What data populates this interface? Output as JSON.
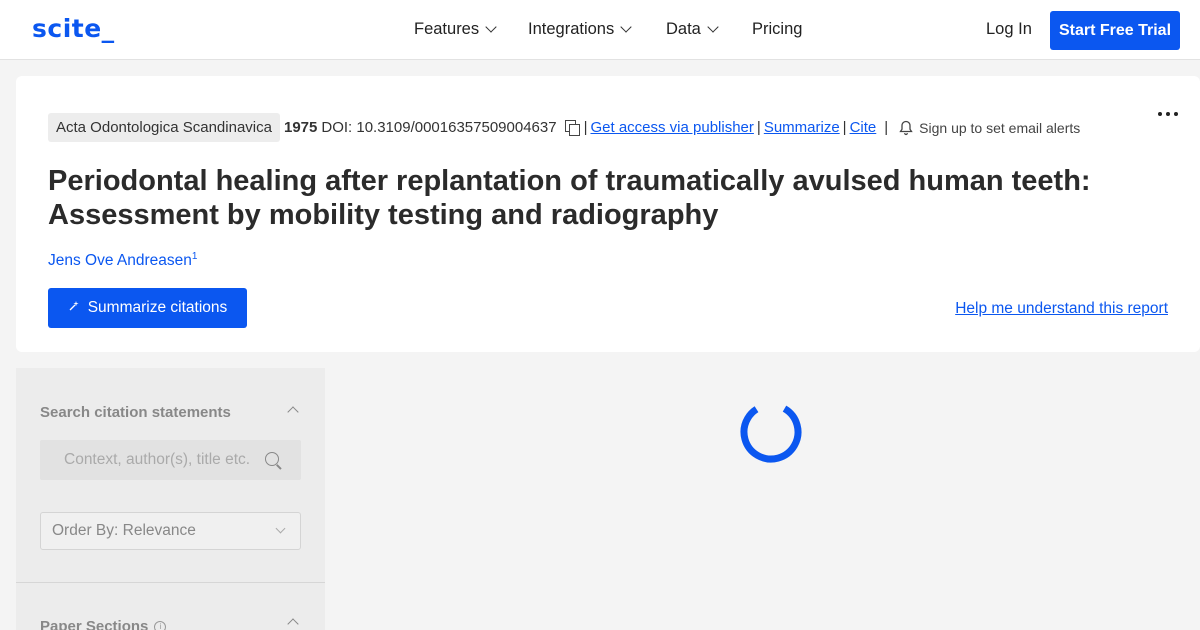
{
  "nav": {
    "logo": "scite_",
    "menu": [
      {
        "label": "Features",
        "has_dropdown": true
      },
      {
        "label": "Integrations",
        "has_dropdown": true
      },
      {
        "label": "Data",
        "has_dropdown": true
      },
      {
        "label": "Pricing",
        "has_dropdown": false
      }
    ],
    "login_label": "Log In",
    "trial_label": "Start Free Trial"
  },
  "paper": {
    "journal": "Acta Odontologica Scandinavica",
    "year": "1975",
    "doi": "DOI: 10.3109/00016357509004637",
    "links": {
      "access": "Get access via publisher",
      "summarize": "Summarize",
      "cite": "Cite"
    },
    "alerts_label": "Sign up to set email alerts",
    "title": "Periodontal healing after replantation of traumatically avulsed human teeth: Assessment by mobility testing and radiography",
    "author": "Jens Ove Andreasen",
    "author_affiliation": "1",
    "summarize_button": "Summarize citations",
    "help_link": "Help me understand this report"
  },
  "sidebar": {
    "search_heading": "Search citation statements",
    "search_placeholder": "Context, author(s), title etc.",
    "order_by": "Order By: Relevance",
    "sections_heading": "Paper Sections",
    "info_glyph": "i"
  },
  "colors": {
    "brand": "#0b57f0",
    "page_bg": "#f4f4f4",
    "card_bg": "#ffffff",
    "sidebar_bg": "#ececec"
  },
  "icons": [
    "chevron-down-icon",
    "copy-icon",
    "bell-icon",
    "more-icon",
    "sparkle-icon",
    "search-icon",
    "chevron-up-icon",
    "info-icon",
    "loading-spinner"
  ]
}
